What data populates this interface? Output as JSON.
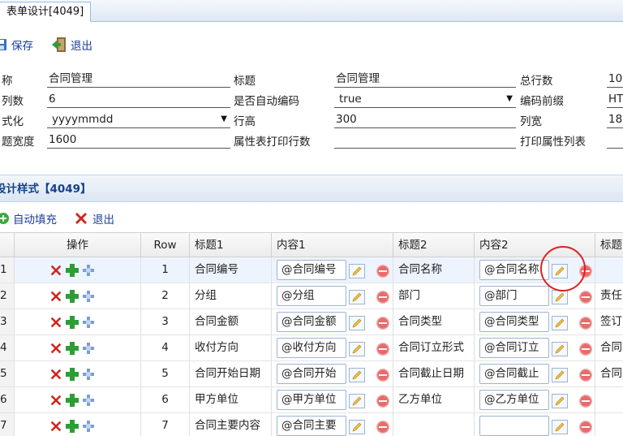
{
  "window": {
    "tab_title": "表单设计[4049]"
  },
  "toolbar": {
    "save_label": "保存",
    "exit_label": "退出"
  },
  "form": {
    "rows": [
      [
        {
          "label": "称",
          "value": "合同管理"
        },
        {
          "label": "标题",
          "value": "合同管理"
        },
        {
          "label": "总行数",
          "value": "10"
        }
      ],
      [
        {
          "label": "列数",
          "value": "6"
        },
        {
          "label": "是否自动编码",
          "value": "true",
          "dropdown": true
        },
        {
          "label": "编码前缀",
          "value": "HT"
        }
      ],
      [
        {
          "label": "式化",
          "value": "yyyymmdd",
          "dropdown": true
        },
        {
          "label": "行高",
          "value": "300"
        },
        {
          "label": "列宽",
          "value": "18"
        }
      ],
      [
        {
          "label": "题宽度",
          "value": "1600"
        },
        {
          "label": "属性表打印行数",
          "value": ""
        },
        {
          "label": "打印属性列表",
          "value": ""
        }
      ]
    ]
  },
  "style_panel": {
    "title": "设计样式【4049】"
  },
  "toolbar2": {
    "autofill_label": "自动填充",
    "exit_label": "退出"
  },
  "grid": {
    "headers": [
      "操作",
      "Row",
      "标题1",
      "内容1",
      "标题2",
      "内容2",
      "标题"
    ],
    "rows": [
      {
        "num": "1",
        "row": "1",
        "t1": "合同编号",
        "c1": "@合同编号",
        "t2": "合同名称",
        "c2": "@合同名称",
        "t3": ""
      },
      {
        "num": "2",
        "row": "2",
        "t1": "分组",
        "c1": "@分组",
        "t2": "部门",
        "c2": "@部门",
        "t3": "责任"
      },
      {
        "num": "3",
        "row": "3",
        "t1": "合同金额",
        "c1": "@合同金额",
        "t2": "合同类型",
        "c2": "@合同类型",
        "t3": "签订"
      },
      {
        "num": "4",
        "row": "4",
        "t1": "收付方向",
        "c1": "@收付方向",
        "t2": "合同订立形式",
        "c2": "@合同订立",
        "t3": "合同"
      },
      {
        "num": "5",
        "row": "5",
        "t1": "合同开始日期",
        "c1": "@合同开始",
        "t2": "合同截止日期",
        "c2": "@合同截止",
        "t3": "合同"
      },
      {
        "num": "6",
        "row": "6",
        "t1": "甲方单位",
        "c1": "@甲方单位",
        "t2": "乙方单位",
        "c2": "@乙方单位",
        "t3": ""
      },
      {
        "num": "7",
        "row": "7",
        "t1": "合同主要内容",
        "c1": "@合同主要",
        "t2": "",
        "c2": "",
        "t3": ""
      }
    ]
  },
  "colors": {
    "link": "#1a3e9c",
    "header_bg": "#dbe6f2",
    "highlight_circle": "#e02020"
  }
}
